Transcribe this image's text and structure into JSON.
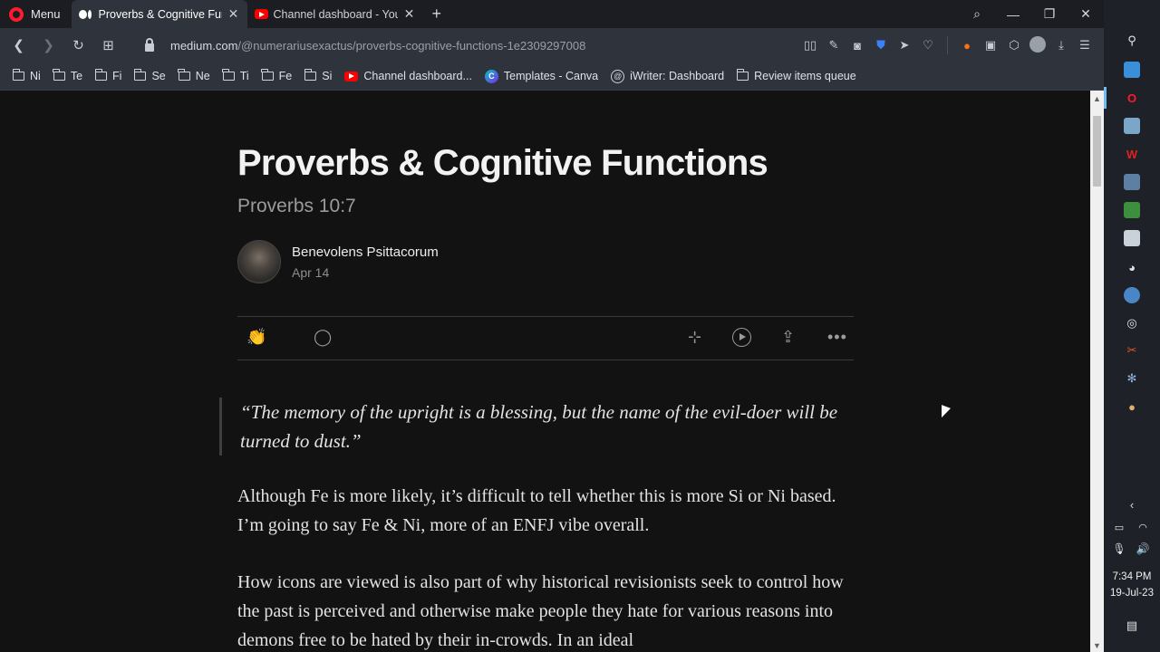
{
  "browser": {
    "menu_label": "Menu",
    "tabs": [
      {
        "label": "Proverbs & Cognitive Funct",
        "favicon": "medium-icon",
        "active": true
      },
      {
        "label": "Channel dashboard - YouTu",
        "favicon": "youtube-icon",
        "active": false
      }
    ],
    "url_host": "medium.com",
    "url_path": "/@numerariusexactus/proverbs-cognitive-functions-1e2309297008",
    "bookmarks": [
      {
        "label": "Ni",
        "icon": "folder-icon"
      },
      {
        "label": "Te",
        "icon": "folder-icon"
      },
      {
        "label": "Fi",
        "icon": "folder-icon"
      },
      {
        "label": "Se",
        "icon": "folder-icon"
      },
      {
        "label": "Ne",
        "icon": "folder-icon"
      },
      {
        "label": "Ti",
        "icon": "folder-icon"
      },
      {
        "label": "Fe",
        "icon": "folder-icon"
      },
      {
        "label": "Si",
        "icon": "folder-icon"
      },
      {
        "label": "Channel dashboard...",
        "icon": "youtube-icon"
      },
      {
        "label": "Templates - Canva",
        "icon": "canva-icon"
      },
      {
        "label": "iWriter: Dashboard",
        "icon": "at-icon"
      },
      {
        "label": "Review items queue",
        "icon": "folder-icon"
      }
    ]
  },
  "article": {
    "title": "Proverbs & Cognitive Functions",
    "subtitle": "Proverbs 10:7",
    "author": "Benevolens Psittacorum",
    "date": "Apr 14",
    "quote": "“The memory of the upright is a blessing, but the name of the evil-doer will be turned to dust.”",
    "paragraph1": "Although Fe is more likely, it’s difficult to tell whether this is more Si or Ni based. I’m going to say Fe & Ni, more of an ENFJ vibe overall.",
    "paragraph2": "How icons are viewed is also part of why historical revisionists seek to control how the past is perceived and otherwise make people they hate for various reasons into demons free to be hated by their in-crowds. In an ideal"
  },
  "taskbar": {
    "time": "7:34 PM",
    "date": "19-Jul-23"
  },
  "colors": {
    "page_bg": "#121212",
    "chrome_bg": "#2f333b",
    "tabbar_bg": "#1b1d22",
    "opera_red": "#ff1b2d"
  }
}
